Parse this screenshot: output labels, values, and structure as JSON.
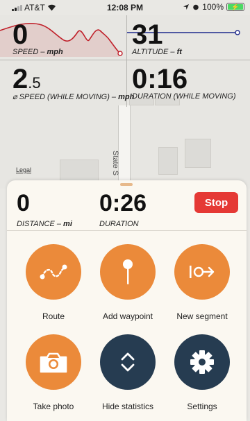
{
  "status_bar": {
    "carrier": "AT&T",
    "time": "12:08 PM",
    "battery": "100%"
  },
  "map": {
    "legal_label": "Legal",
    "street_name": "State S"
  },
  "stats": {
    "speed": {
      "value": "0",
      "label": "SPEED",
      "unit": "mph"
    },
    "altitude": {
      "value": "31",
      "label": "ALTITUDE",
      "unit": "ft"
    },
    "avg_speed": {
      "value_int": "2",
      "value_dec": ".5",
      "label": "⌀ SPEED (WHILE MOVING)",
      "unit": "mph"
    },
    "duration_moving": {
      "value": "0:16",
      "label": "DURATION (WHILE MOVING)"
    }
  },
  "sheet": {
    "distance": {
      "value": "0",
      "label": "DISTANCE",
      "unit": "mi"
    },
    "duration": {
      "value": "0:26",
      "label": "DURATION"
    },
    "stop_label": "Stop",
    "actions": [
      {
        "label": "Route",
        "icon": "route-icon"
      },
      {
        "label": "Add waypoint",
        "icon": "pin-icon"
      },
      {
        "label": "New segment",
        "icon": "new-segment-icon"
      },
      {
        "label": "Take photo",
        "icon": "camera-icon"
      },
      {
        "label": "Hide statistics",
        "icon": "chevron-up-down-icon"
      },
      {
        "label": "Settings",
        "icon": "gear-icon"
      }
    ]
  },
  "colors": {
    "accent_orange": "#eb8a3a",
    "dark_button": "#263c51",
    "stop_red": "#e53935",
    "speed_graph": "#c0202a",
    "altitude_graph": "#1f2a8c"
  }
}
